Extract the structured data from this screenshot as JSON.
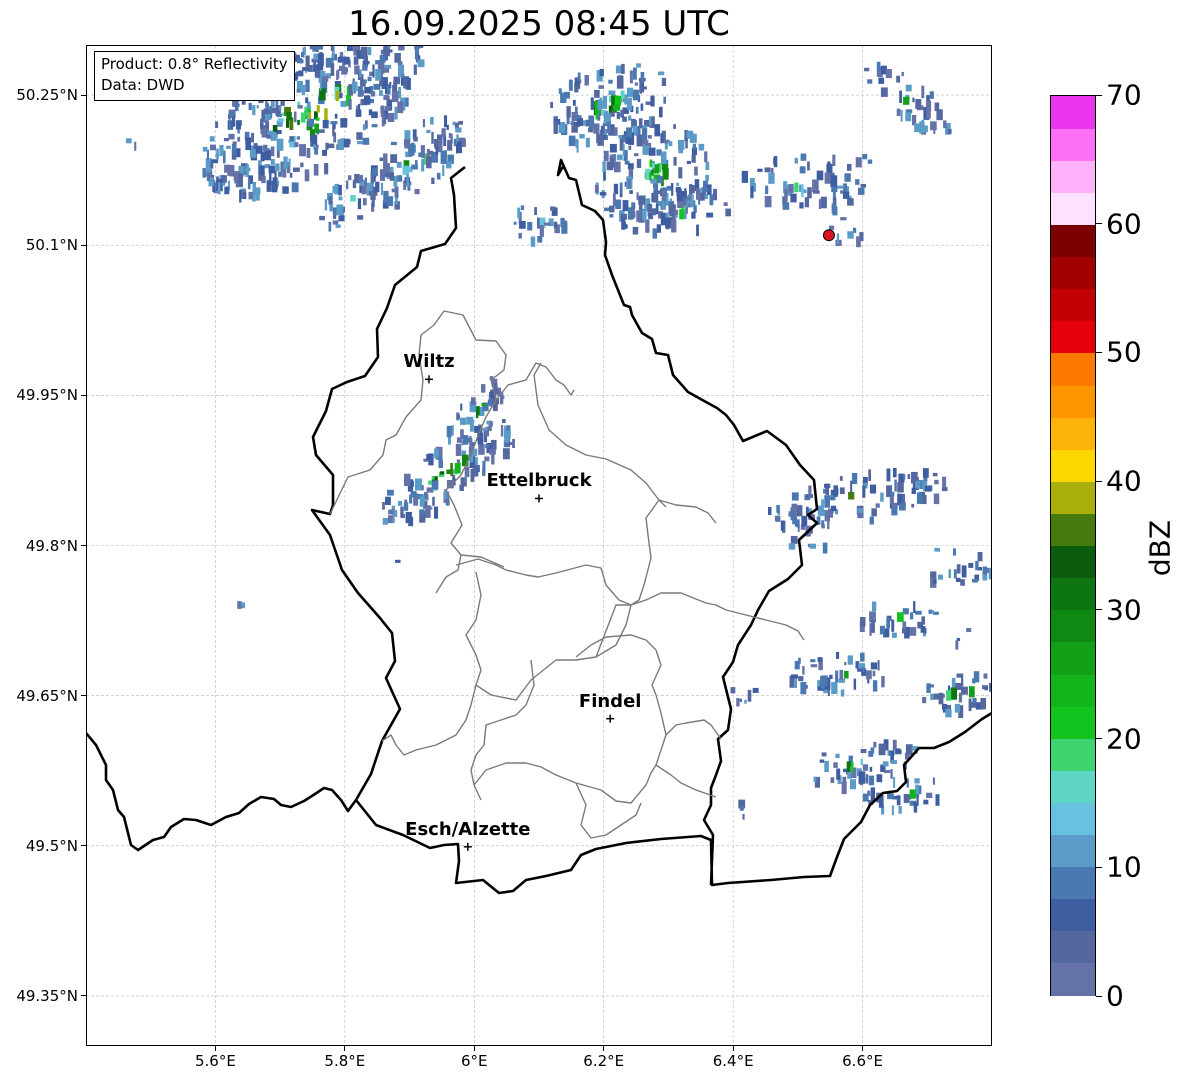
{
  "title": "16.09.2025 08:45 UTC",
  "info": {
    "product": "Product: 0.8° Reflectivity",
    "source": "Data: DWD"
  },
  "axes": {
    "lat_labels": [
      "50.25°N",
      "50.1°N",
      "49.95°N",
      "49.8°N",
      "49.65°N",
      "49.5°N",
      "49.35°N"
    ],
    "lat_values": [
      50.25,
      50.1,
      49.95,
      49.8,
      49.65,
      49.5,
      49.35
    ],
    "lon_labels": [
      "5.6°E",
      "5.8°E",
      "6°E",
      "6.2°E",
      "6.4°E",
      "6.6°E"
    ],
    "lon_values": [
      5.6,
      5.8,
      6.0,
      6.2,
      6.4,
      6.6
    ],
    "lon_range": [
      5.4,
      6.8
    ],
    "lat_range": [
      49.3,
      50.3
    ]
  },
  "cities": [
    {
      "name": "Wiltz",
      "lon": 5.93,
      "lat": 49.966
    },
    {
      "name": "Ettelbruck",
      "lon": 6.1,
      "lat": 49.847
    },
    {
      "name": "Findel",
      "lon": 6.21,
      "lat": 49.627
    },
    {
      "name": "Esch/Alzette",
      "lon": 5.99,
      "lat": 49.499
    }
  ],
  "radar_site": {
    "lon": 6.548,
    "lat": 50.11,
    "color": "#e0141e"
  },
  "colorbar": {
    "label": "dBZ",
    "min": 0,
    "max": 70,
    "step": 2.5,
    "tick_labels": [
      "0",
      "10",
      "20",
      "30",
      "40",
      "50",
      "60",
      "70"
    ],
    "colors": [
      "#6572a8",
      "#54679e",
      "#3f5ea2",
      "#4a78b1",
      "#5b9bc7",
      "#66c2de",
      "#5fd6c4",
      "#3ed470",
      "#12c41d",
      "#12b31b",
      "#11a018",
      "#108914",
      "#0d7612",
      "#0b5c0e",
      "#467a0d",
      "#a9b00d",
      "#fcd600",
      "#fbb30a",
      "#fb9600",
      "#fc7a00",
      "#e30009",
      "#c30004",
      "#a00000",
      "#7c0000",
      "#fee1fd",
      "#feb2fb",
      "#fd70f6",
      "#ea35ec"
    ]
  },
  "precip_cells": [
    {
      "name": "north-west band",
      "lon": [
        5.73,
        5.97
      ],
      "lat": [
        50.11,
        50.25
      ],
      "max_dbz": 30
    },
    {
      "name": "north-central band",
      "lon": [
        6.08,
        6.33
      ],
      "lat": [
        50.11,
        50.28
      ],
      "max_dbz": 25
    },
    {
      "name": "wiltz band",
      "lon": [
        5.78,
        6.01
      ],
      "lat": [
        49.85,
        49.95
      ],
      "max_dbz": 20
    },
    {
      "name": "east band",
      "lon": [
        6.43,
        6.78
      ],
      "lat": [
        49.52,
        49.87
      ],
      "max_dbz": 22
    }
  ]
}
